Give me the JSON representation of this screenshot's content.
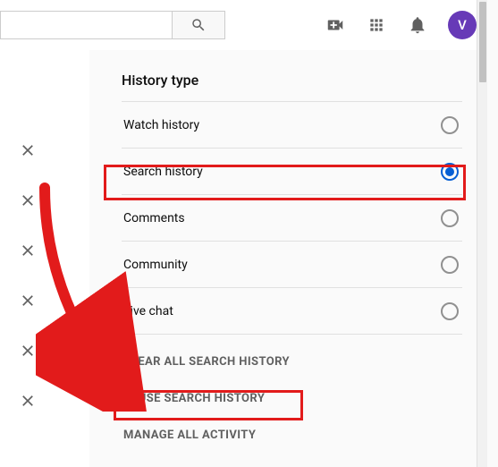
{
  "topbar": {
    "search_value": "",
    "search_placeholder": "",
    "avatar_initial": "V"
  },
  "panel": {
    "title": "History type",
    "options": [
      {
        "label": "Watch history",
        "selected": false
      },
      {
        "label": "Search history",
        "selected": true
      },
      {
        "label": "Comments",
        "selected": false
      },
      {
        "label": "Community",
        "selected": false
      },
      {
        "label": "Live chat",
        "selected": false
      }
    ],
    "actions": {
      "clear": "CLEAR ALL SEARCH HISTORY",
      "pause": "PAUSE SEARCH HISTORY",
      "manage": "MANAGE ALL ACTIVITY"
    }
  }
}
